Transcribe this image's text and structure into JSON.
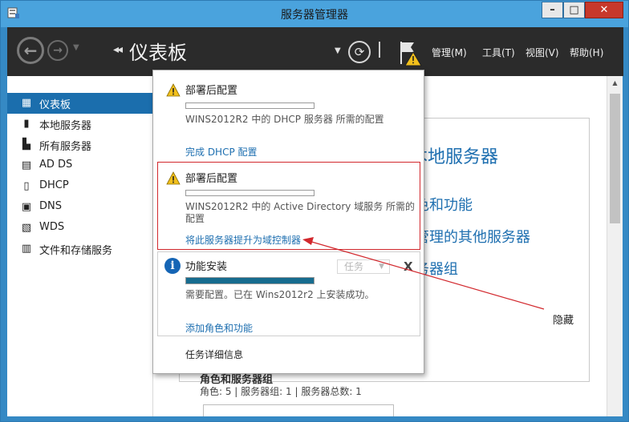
{
  "window": {
    "title": "服务器管理器",
    "controls": {
      "minimize": "–",
      "maximize": "□",
      "close": "✕"
    }
  },
  "header": {
    "breadcrumb_arrows": "◂◂",
    "title": "仪表板",
    "menu": [
      {
        "label": "管理(M)"
      },
      {
        "label": "工具(T)"
      },
      {
        "label": "视图(V)"
      },
      {
        "label": "帮助(H)"
      }
    ]
  },
  "sidebar": {
    "items": [
      {
        "label": "仪表板",
        "icon": "dashboard-icon",
        "active": true
      },
      {
        "label": "本地服务器",
        "icon": "server-icon"
      },
      {
        "label": "所有服务器",
        "icon": "servers-icon"
      },
      {
        "label": "AD DS",
        "icon": "ad-ds-icon"
      },
      {
        "label": "DHCP",
        "icon": "dhcp-icon"
      },
      {
        "label": "DNS",
        "icon": "dns-icon"
      },
      {
        "label": "WDS",
        "icon": "wds-icon"
      },
      {
        "label": "文件和存储服务",
        "icon": "file-storage-icon"
      }
    ]
  },
  "main": {
    "links": [
      "本地服务器",
      "色和功能",
      "管理的其他服务器",
      "务器组"
    ],
    "hide": "隐藏",
    "roles_heading": "角色和服务器组",
    "roles_summary": "角色: 5 | 服务器组: 1 | 服务器总数: 1"
  },
  "notifications": {
    "items": [
      {
        "icon": "warning-icon",
        "title": "部署后配置",
        "description": "WINS2012R2 中的 DHCP 服务器 所需的配置",
        "link": "完成 DHCP 配置",
        "progress": 0
      },
      {
        "icon": "warning-icon",
        "title": "部署后配置",
        "description": "WINS2012R2 中的 Active Directory 域服务 所需的配置",
        "link": "将此服务器提升为域控制器",
        "progress": 0
      },
      {
        "icon": "info-icon",
        "title": "功能安装",
        "description": "需要配置。已在 Wins2012r2 上安装成功。",
        "link": "添加角色和功能",
        "progress": 1.0,
        "task_select": "任务",
        "close": "X"
      }
    ],
    "task_details": "任务详细信息"
  },
  "colors": {
    "accent": "#1b6ead",
    "link": "#1e6fb0",
    "warning": "#f2c01c",
    "highlight": "#d2282d",
    "progress": "#176c8f"
  }
}
